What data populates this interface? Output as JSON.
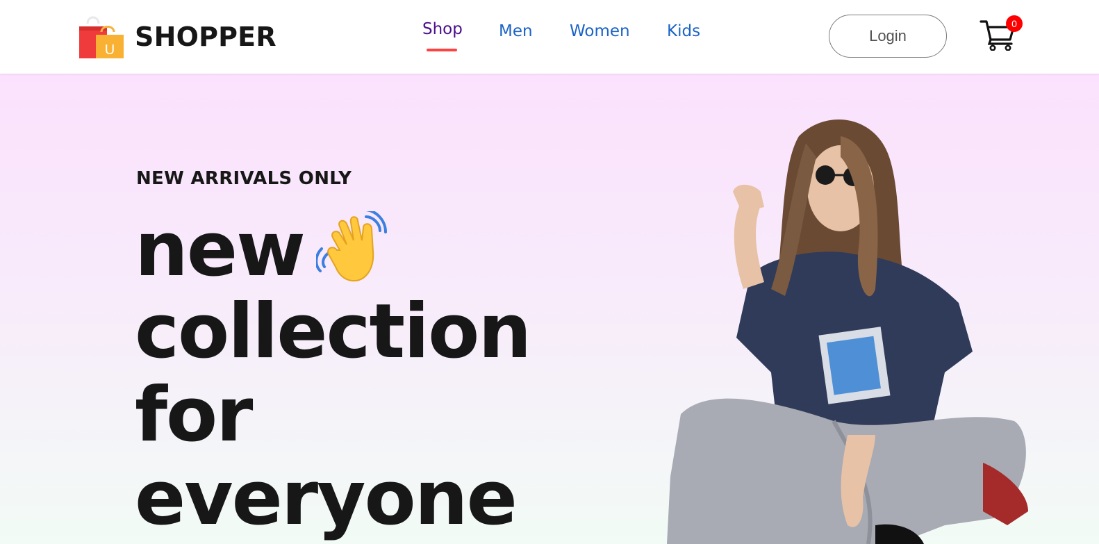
{
  "header": {
    "brand": "SHOPPER",
    "logo_badge": "U",
    "nav": [
      {
        "label": "Shop",
        "active": true
      },
      {
        "label": "Men",
        "active": false
      },
      {
        "label": "Women",
        "active": false
      },
      {
        "label": "Kids",
        "active": false
      }
    ],
    "login_label": "Login",
    "cart_count": "0",
    "icons": {
      "logo": "shopping-bags-icon",
      "cart": "cart-icon"
    }
  },
  "hero": {
    "tagline": "NEW ARRIVALS ONLY",
    "headline": [
      "new",
      "collection",
      "for",
      "everyone"
    ],
    "emoji": "waving-hand-icon",
    "image": "model-photo"
  },
  "colors": {
    "nav_link": "#1b63c6",
    "nav_active": "#4b0f8a",
    "underline": "#ff4141",
    "badge": "#ff0000",
    "hero_top": "#fbe1fd",
    "hero_bottom": "#f2fbf6"
  }
}
